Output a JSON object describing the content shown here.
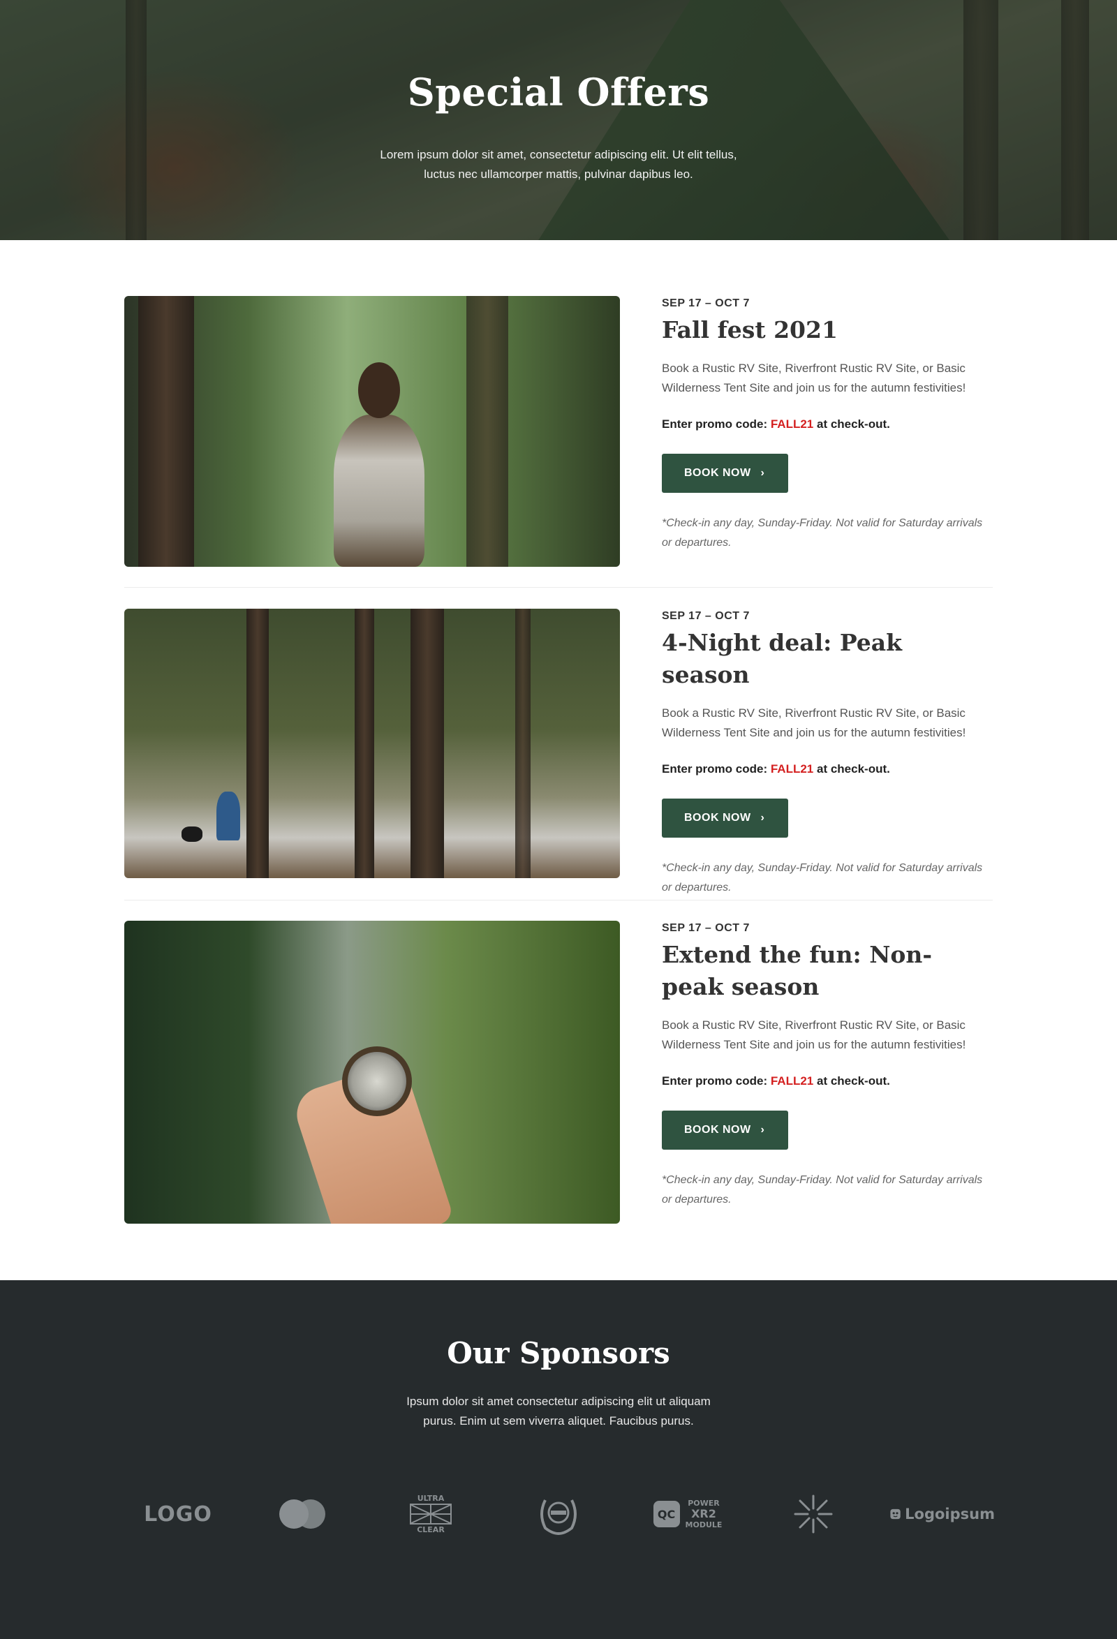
{
  "hero": {
    "title": "Special Offers",
    "subtitle": "Lorem ipsum dolor sit amet, consectetur adipiscing elit. Ut elit tellus, luctus nec ullamcorper mattis, pulvinar dapibus leo."
  },
  "offers": [
    {
      "date": "SEP 17 – OCT 7",
      "title": "Fall fest 2021",
      "description": "Book a Rustic RV Site, Riverfront Rustic RV Site, or Basic Wilderness Tent Site and join us for the autumn festivities!",
      "promo_prefix": "Enter promo code: ",
      "promo_code": "FALL21",
      "promo_suffix": " at check-out.",
      "button_label": "BOOK NOW",
      "note": "*Check-in any day, Sunday-Friday. Not valid for Saturday arrivals or departures."
    },
    {
      "date": "SEP 17 – OCT 7",
      "title": "4-Night deal: Peak season",
      "description": "Book a Rustic RV Site, Riverfront Rustic RV Site, or Basic Wilderness Tent Site and join us for the autumn festivities!",
      "promo_prefix": "Enter promo code: ",
      "promo_code": "FALL21",
      "promo_suffix": " at check-out.",
      "button_label": "BOOK NOW",
      "note": "*Check-in any day, Sunday-Friday. Not valid for Saturday arrivals or departures."
    },
    {
      "date": "SEP 17 – OCT 7",
      "title": "Extend the fun: Non-peak season",
      "description": "Book a Rustic RV Site, Riverfront Rustic RV Site, or Basic Wilderness Tent Site and join us for the autumn festivities!",
      "promo_prefix": "Enter promo code: ",
      "promo_code": "FALL21",
      "promo_suffix": " at check-out.",
      "button_label": "BOOK NOW",
      "note": "*Check-in any day, Sunday-Friday. Not valid for Saturday arrivals or departures."
    }
  ],
  "sponsors": {
    "title": "Our Sponsors",
    "subtitle": "Ipsum dolor sit amet consectetur adipiscing elit ut aliquam purus. Enim ut sem viverra aliquet. Faucibus purus.",
    "logos": [
      {
        "name": "logo-wordmark",
        "text": "LOGO"
      },
      {
        "name": "circles-logo",
        "text": ""
      },
      {
        "name": "ultra-clear-logo",
        "text_top": "ULTRA",
        "text_bottom": "CLEAR"
      },
      {
        "name": "laurel-badge-logo",
        "text": ""
      },
      {
        "name": "qc-power-module-logo",
        "badge": "QC",
        "line1": "POWER",
        "line2": "XR2",
        "line3": "MODULE"
      },
      {
        "name": "asterisk-logo",
        "text": ""
      },
      {
        "name": "logoipsum-logo",
        "text": "Logoipsum"
      }
    ]
  },
  "colors": {
    "button": "#2f5340",
    "promo_code": "#d42020",
    "sponsors_bg": "#262b2d",
    "logo_gray": "#8a8f92"
  }
}
